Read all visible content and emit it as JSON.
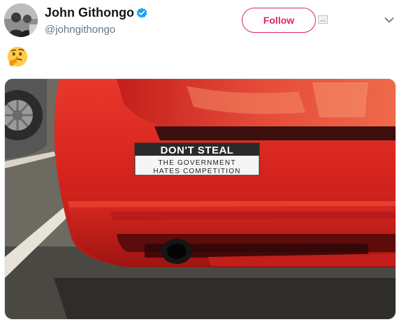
{
  "tweet": {
    "display_name": "John Githongo",
    "handle": "@johngithongo",
    "verified": true,
    "follow_label": "Follow",
    "emoji": "thinking-face",
    "accent_color": "#e0245e"
  },
  "media": {
    "sticker_line1": "DON'T STEAL",
    "sticker_line2": "THE GOVERNMENT",
    "sticker_line3": "HATES COMPETITION"
  }
}
